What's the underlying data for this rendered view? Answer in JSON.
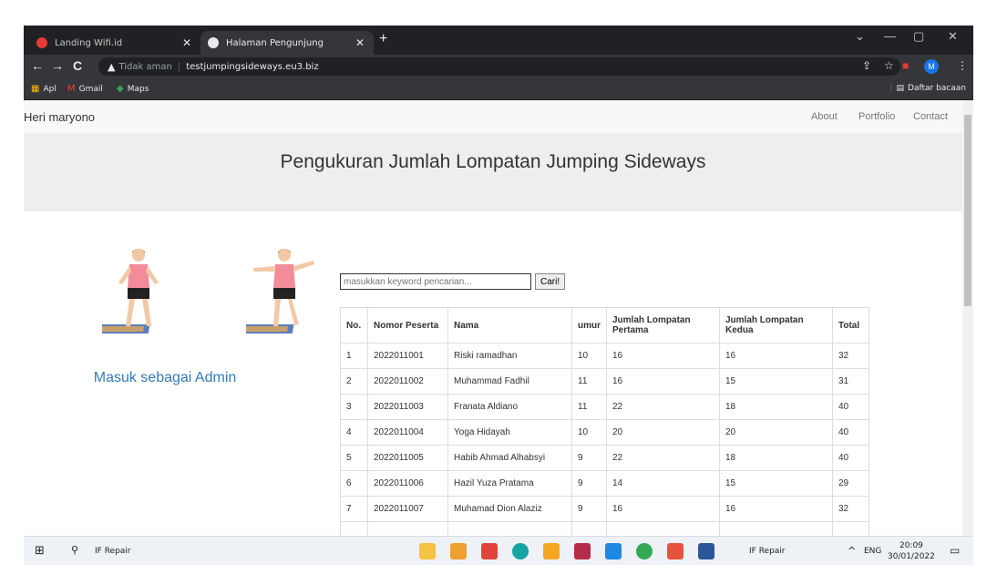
{
  "browser": {
    "tabs": [
      {
        "title": "Landing Wifi.id",
        "active": false
      },
      {
        "title": "Halaman Pengunjung",
        "active": true
      }
    ],
    "new_tab": "+",
    "window_controls": [
      "⌄",
      "—",
      "▢",
      "✕"
    ],
    "nav": {
      "back": "←",
      "forward": "→",
      "reload": "C"
    },
    "security_warning": "Tidak aman",
    "url": "testjumpingsideways.eu3.biz",
    "profile_initial": "M",
    "bookmarks": [
      {
        "label": "Apl",
        "icon": "apps-grid-icon"
      },
      {
        "label": "Gmail",
        "icon": "gmail-icon"
      },
      {
        "label": "Maps",
        "icon": "maps-icon"
      }
    ],
    "reading_list": "Daftar bacaan"
  },
  "page": {
    "brand": "Heri maryono",
    "nav_links": [
      "About",
      "Portfolio",
      "Contact"
    ],
    "heading": "Pengukuran Jumlah Lompatan Jumping Sideways",
    "admin_link": "Masuk sebagai Admin",
    "search": {
      "placeholder": "masukkan keyword pencarian...",
      "button": "Cari!"
    },
    "table": {
      "headers": [
        "No.",
        "Nomor Peserta",
        "Nama",
        "umur",
        "Jumlah Lompatan Pertama",
        "Jumlah Lompatan Kedua",
        "Total"
      ],
      "rows": [
        [
          "1",
          "2022011001",
          "Riski ramadhan",
          "10",
          "16",
          "16",
          "32"
        ],
        [
          "2",
          "2022011002",
          "Muhammad Fadhil",
          "11",
          "16",
          "15",
          "31"
        ],
        [
          "3",
          "2022011003",
          "Franata Aldiano",
          "11",
          "22",
          "18",
          "40"
        ],
        [
          "4",
          "2022011004",
          "Yoga Hidayah",
          "10",
          "20",
          "20",
          "40"
        ],
        [
          "5",
          "2022011005",
          "Habib Ahmad Alhabsyi",
          "9",
          "22",
          "18",
          "40"
        ],
        [
          "6",
          "2022011006",
          "Hazil Yuza Pratama",
          "9",
          "14",
          "15",
          "29"
        ],
        [
          "7",
          "2022011007",
          "Muhamad Dion Alaziz",
          "9",
          "16",
          "16",
          "32"
        ]
      ]
    }
  },
  "taskbar": {
    "search_text": "IF Repair",
    "active_app_text": "IF Repair",
    "language": "ENG",
    "time": "20:09",
    "date": "30/01/2022"
  },
  "colors": {
    "chrome_dark": "#202124",
    "chrome_toolbar": "#35363a",
    "navbar_bg": "#f8f8f8",
    "jumbotron_bg": "#eeeeee",
    "link_blue": "#337ab7",
    "shirt_pink": "#f28b9a",
    "mat_blue": "#5b7fb8"
  }
}
